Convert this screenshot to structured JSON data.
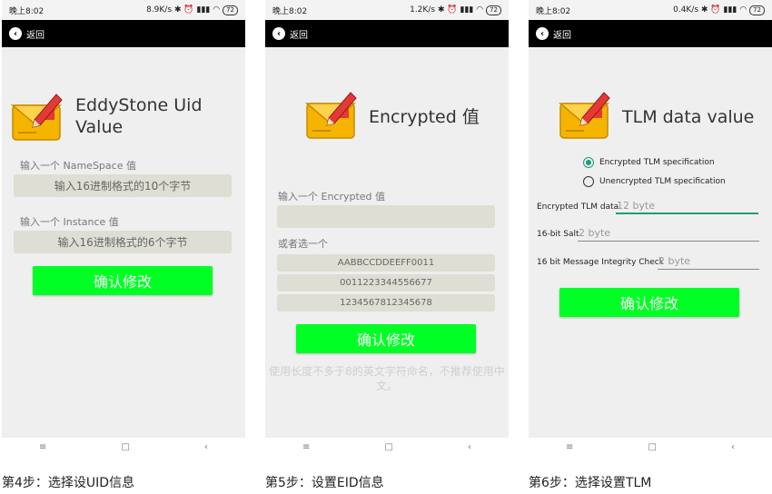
{
  "common": {
    "status_time": "晚上8:02",
    "status_icons": "✱ ⏰ ▮▮▮ ◠",
    "battery": "72",
    "back_label": "返回",
    "nav_menu": "≡",
    "nav_home": "□",
    "nav_back": "‹"
  },
  "panel1": {
    "speed": "8.9K/s",
    "heading": "EddyStone Uid Value",
    "ns_label": "输入一个 NameSpace 值",
    "ns_placeholder": "输入16进制格式的10个字节",
    "inst_label": "输入一个 Instance 值",
    "inst_placeholder": "输入16进制格式的6个字节",
    "confirm": "确认修改",
    "caption": "第4步：选择设UID信息"
  },
  "panel2": {
    "speed": "1.2K/s",
    "heading": "Encrypted 值",
    "enc_label": "输入一个 Encrypted 值",
    "enc_value": "",
    "or_label": "或者选一个",
    "options": [
      "AABBCCDDEEFF0011",
      "0011223344556677",
      "1234567812345678"
    ],
    "confirm": "确认修改",
    "hint": "使用长度不多于8的英文字符命名，不推荐使用中文。",
    "caption": "第5步：设置EID信息"
  },
  "panel3": {
    "speed": "0.4K/s",
    "heading": "TLM data value",
    "radio_encrypted": "Encrypted TLM specification",
    "radio_unencrypted": "Unencrypted TLM specification",
    "selected_radio": "encrypted",
    "row1_label": "Encrypted TLM data",
    "row1_placeholder": "12 byte",
    "row2_label": "16-bit Salt",
    "row2_placeholder": "2 byte",
    "row3_label": "16 bit Message Integrity Check",
    "row3_placeholder": "2 byte",
    "confirm": "确认修改",
    "caption": "第6步：选择设置TLM"
  }
}
